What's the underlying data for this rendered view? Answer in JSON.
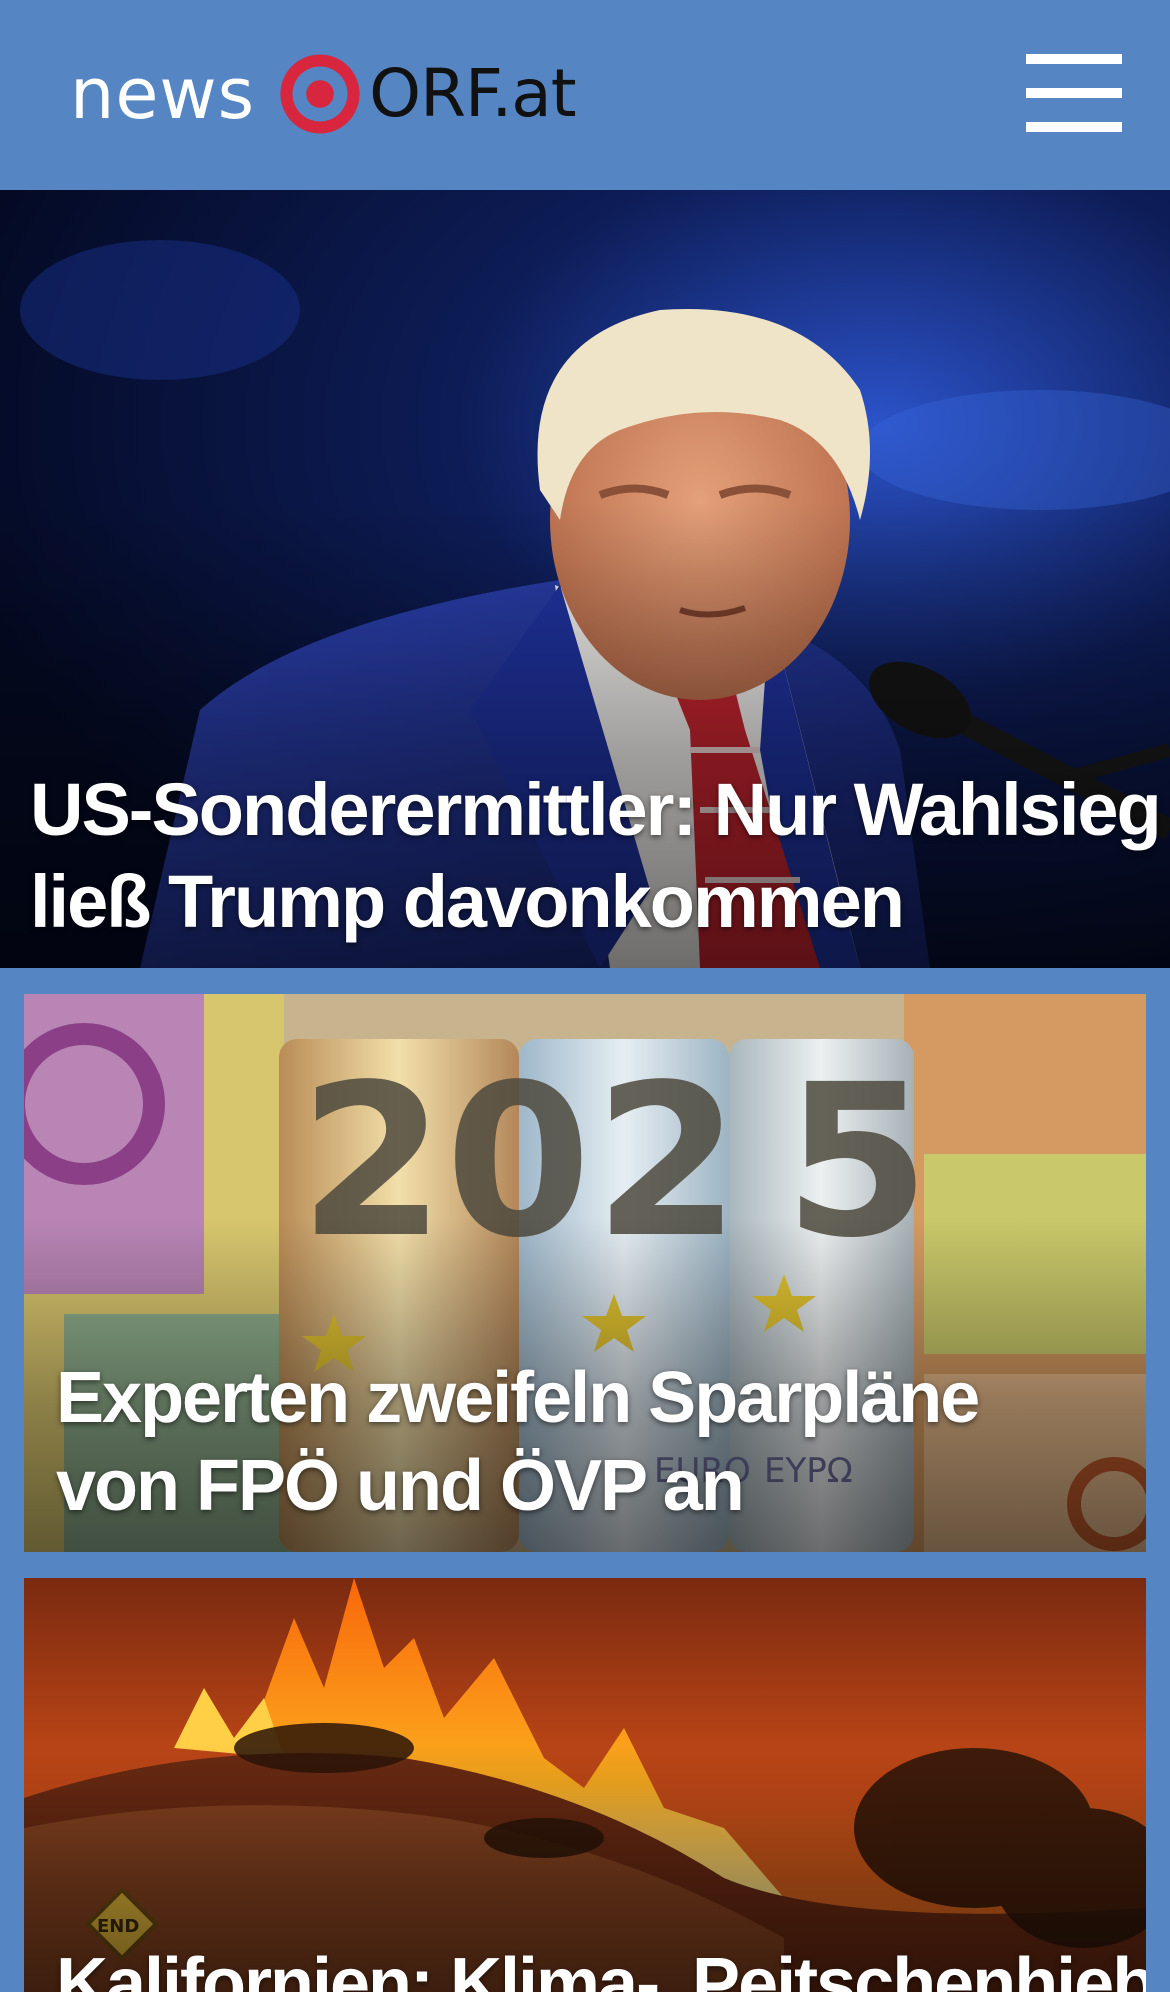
{
  "header": {
    "logo_prefix": "news",
    "logo_suffix": "ORF.at",
    "logo_color_accent": "#d7263d",
    "background": "#5586c3",
    "menu_icon": "hamburger-menu-icon"
  },
  "articles": [
    {
      "headline": "US-Sonderermittler: Nur Wahlsieg ließ Trump davonkommen",
      "image": "photo of a man in a blue suit at a microphone"
    },
    {
      "headline": "Experten zweifeln Sparpläne von FPÖ und ÖVP an",
      "image": "rolled euro banknotes showing 2025"
    },
    {
      "headline": "Kalifornien: Klima-„Peitschenhiebe“",
      "image": "wildfire on a hillside with END road sign"
    }
  ]
}
